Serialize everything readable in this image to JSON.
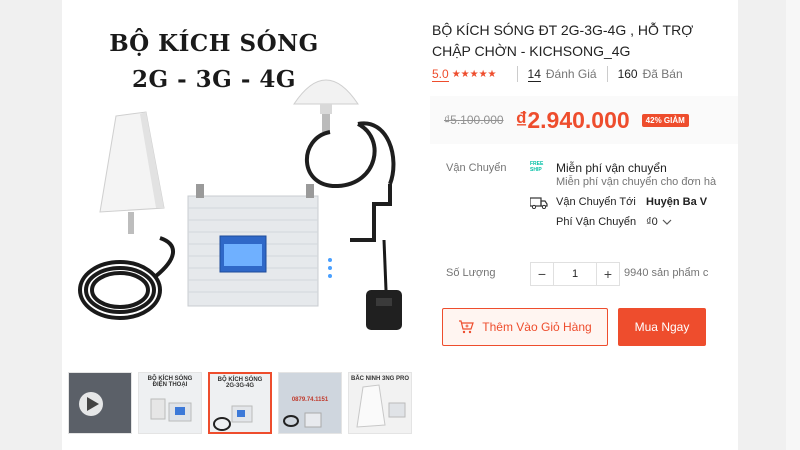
{
  "hero": {
    "line1": "BỘ KÍCH SÓNG",
    "line2": "2G - 3G - 4G"
  },
  "thumbnails": [
    {
      "label": ""
    },
    {
      "label": "BỘ KÍCH SÓNG ĐIỆN THOẠI"
    },
    {
      "label": "BỘ KÍCH SÓNG 2G-3G-4G"
    },
    {
      "label": "0879.74.1151"
    },
    {
      "label": "BẮC NINH 3NG PRO"
    }
  ],
  "product": {
    "title_line1": "BỘ KÍCH SÓNG ĐT 2G-3G-4G , HỖ TRỢ",
    "title_line2": "CHẬP CHỜN - KICHSONG_4G",
    "rating": "5.0",
    "stars": "★★★★★",
    "reviews_count": "14",
    "reviews_label": "Đánh Giá",
    "sold_count": "160",
    "sold_label": "Đã Bán"
  },
  "price": {
    "old": "₫5.100.000",
    "new": "₫2.940.000",
    "discount": "42% GIẢM"
  },
  "shipping": {
    "label": "Vận Chuyển",
    "free_icon_line1": "FREE",
    "free_icon_line2": "SHIP",
    "free_title": "Miễn phí vận chuyển",
    "free_sub": "Miễn phí vận chuyển cho đơn hà",
    "to_label": "Vận Chuyển Tới",
    "to_value": "Huyện Ba V",
    "fee_label": "Phí Vận Chuyển",
    "fee_value": "₫0"
  },
  "quantity": {
    "label": "Số Lượng",
    "minus": "−",
    "value": "1",
    "plus": "+",
    "stock": "9940 sản phẩm c"
  },
  "actions": {
    "add_to_cart": "Thêm Vào Giỏ Hàng",
    "buy_now": "Mua Ngay"
  },
  "colors": {
    "accent": "#ee4d2d",
    "free_ship": "#00bfa5"
  }
}
